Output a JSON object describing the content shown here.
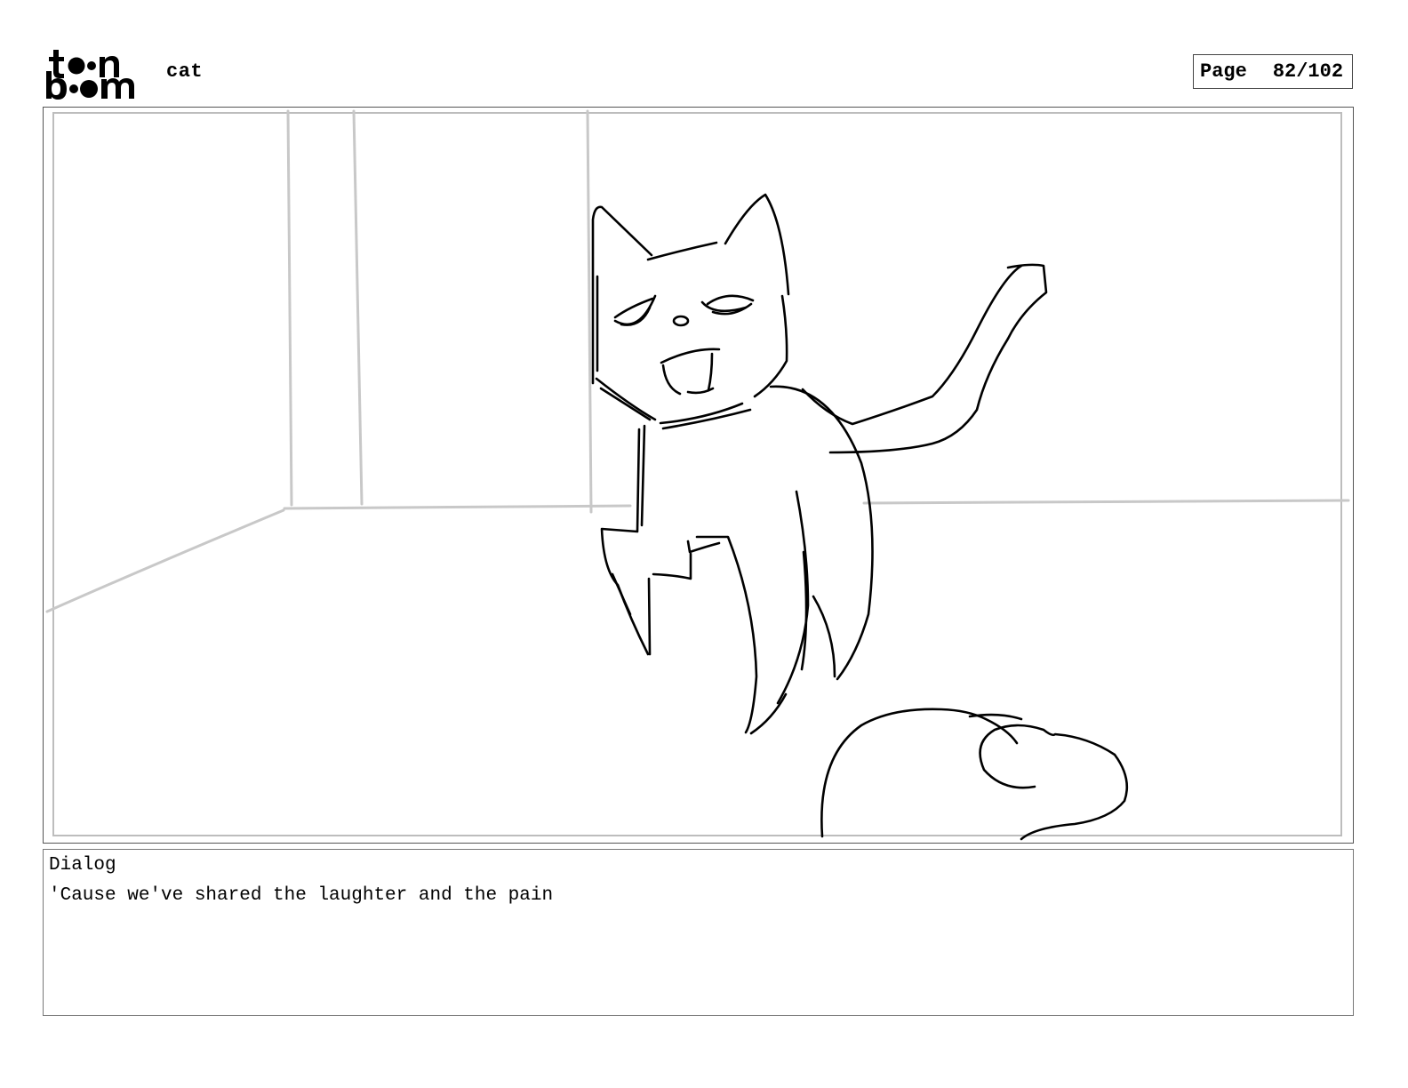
{
  "header": {
    "logo_top": "toon",
    "logo_bottom": "boom",
    "project_title": "cat",
    "page_label": "Page",
    "page_number": "82/102"
  },
  "panel": {
    "drawing": "cat-sketch"
  },
  "dialog": {
    "label": "Dialog",
    "text": "'Cause we've shared the laughter and the pain"
  }
}
